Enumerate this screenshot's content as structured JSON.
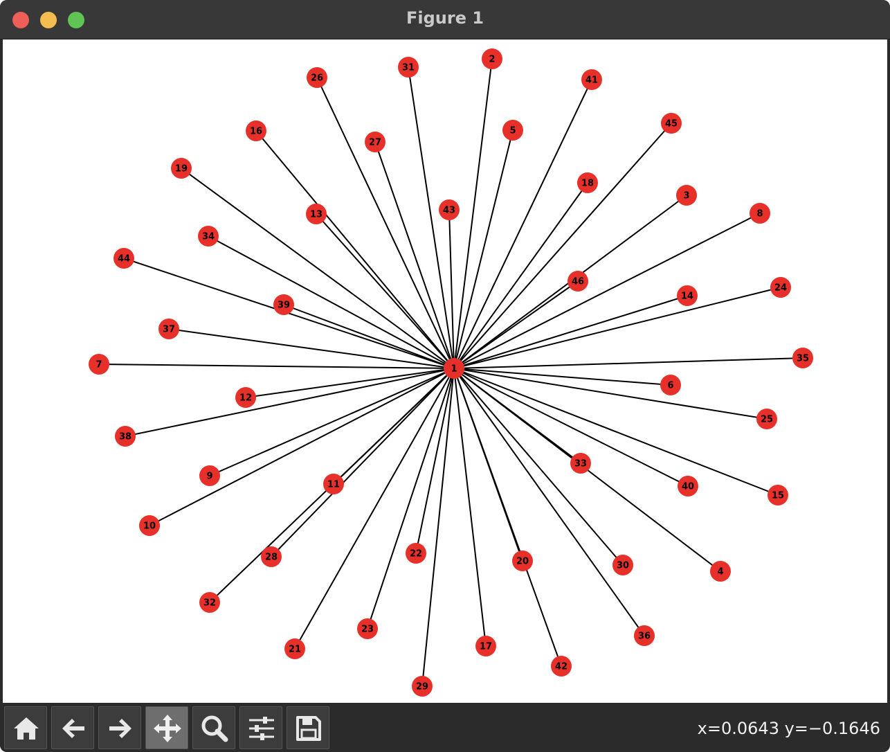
{
  "window": {
    "title": "Figure 1"
  },
  "toolbar": {
    "buttons": [
      {
        "name": "home-button",
        "icon": "home-icon"
      },
      {
        "name": "back-button",
        "icon": "arrow-left-icon"
      },
      {
        "name": "forward-button",
        "icon": "arrow-right-icon"
      },
      {
        "name": "pan-button",
        "icon": "move-icon",
        "active": true
      },
      {
        "name": "zoom-button",
        "icon": "magnifier-icon"
      },
      {
        "name": "configure-subplots-button",
        "icon": "sliders-icon"
      },
      {
        "name": "save-button",
        "icon": "floppy-disk-icon"
      }
    ],
    "coordinates": "x=0.0643 y=−0.1646"
  },
  "colors": {
    "node": "#e8302a",
    "edge": "#000000",
    "titlebar": "#383838",
    "toolbar": "#2b2b2b"
  },
  "chart_data": {
    "type": "network",
    "center": "1",
    "nodes": [
      "1",
      "2",
      "3",
      "4",
      "5",
      "6",
      "7",
      "8",
      "9",
      "10",
      "11",
      "12",
      "13",
      "14",
      "15",
      "16",
      "17",
      "18",
      "19",
      "20",
      "21",
      "22",
      "23",
      "24",
      "25",
      "26",
      "27",
      "28",
      "29",
      "30",
      "31",
      "32",
      "33",
      "34",
      "35",
      "36",
      "37",
      "38",
      "39",
      "40",
      "41",
      "42",
      "43",
      "44",
      "45",
      "46"
    ],
    "edges": [
      [
        "1",
        "2"
      ],
      [
        "1",
        "3"
      ],
      [
        "1",
        "4"
      ],
      [
        "1",
        "5"
      ],
      [
        "1",
        "6"
      ],
      [
        "1",
        "7"
      ],
      [
        "1",
        "8"
      ],
      [
        "1",
        "9"
      ],
      [
        "1",
        "10"
      ],
      [
        "1",
        "11"
      ],
      [
        "1",
        "12"
      ],
      [
        "1",
        "13"
      ],
      [
        "1",
        "14"
      ],
      [
        "1",
        "15"
      ],
      [
        "1",
        "16"
      ],
      [
        "1",
        "17"
      ],
      [
        "1",
        "18"
      ],
      [
        "1",
        "19"
      ],
      [
        "1",
        "20"
      ],
      [
        "1",
        "21"
      ],
      [
        "1",
        "22"
      ],
      [
        "1",
        "23"
      ],
      [
        "1",
        "24"
      ],
      [
        "1",
        "25"
      ],
      [
        "1",
        "26"
      ],
      [
        "1",
        "27"
      ],
      [
        "1",
        "28"
      ],
      [
        "1",
        "29"
      ],
      [
        "1",
        "30"
      ],
      [
        "1",
        "31"
      ],
      [
        "1",
        "32"
      ],
      [
        "1",
        "33"
      ],
      [
        "1",
        "34"
      ],
      [
        "1",
        "35"
      ],
      [
        "1",
        "36"
      ],
      [
        "1",
        "37"
      ],
      [
        "1",
        "38"
      ],
      [
        "1",
        "39"
      ],
      [
        "1",
        "40"
      ],
      [
        "1",
        "41"
      ],
      [
        "1",
        "42"
      ],
      [
        "1",
        "43"
      ],
      [
        "1",
        "44"
      ],
      [
        "1",
        "45"
      ],
      [
        "1",
        "46"
      ]
    ]
  }
}
